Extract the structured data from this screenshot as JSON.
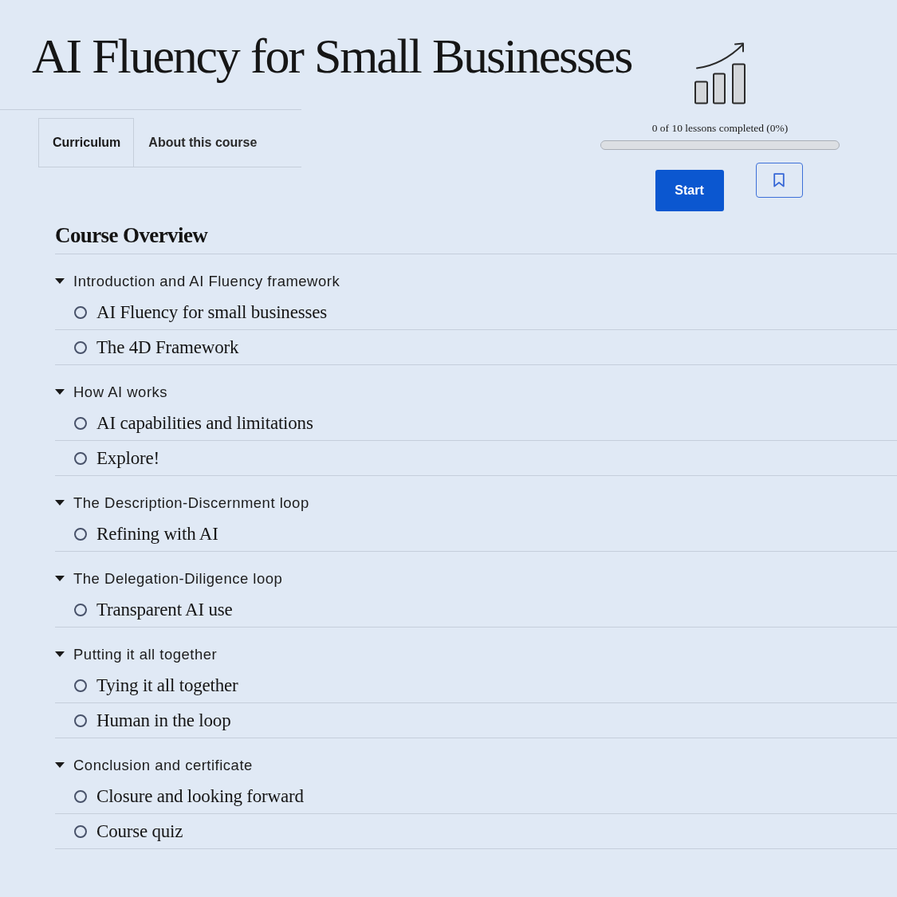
{
  "course": {
    "title": "AI Fluency for Small Businesses"
  },
  "tabs": [
    {
      "label": "Curriculum",
      "selected": true
    },
    {
      "label": "About this course",
      "selected": false
    }
  ],
  "progress": {
    "text": "0 of 10 lessons completed (0%)",
    "level": 0
  },
  "actions": {
    "start_button": "Start"
  },
  "overview": {
    "heading": "Course Overview",
    "sections": [
      {
        "title": "Introduction and AI Fluency framework",
        "expanded": true,
        "lessons": [
          {
            "title": "AI Fluency for small businesses",
            "completed": false
          },
          {
            "title": "The 4D Framework",
            "completed": false
          }
        ]
      },
      {
        "title": "How AI works",
        "expanded": true,
        "lessons": [
          {
            "title": "AI capabilities and limitations",
            "completed": false
          },
          {
            "title": "Explore!",
            "completed": false
          }
        ]
      },
      {
        "title": "The Description-Discernment loop",
        "expanded": true,
        "lessons": [
          {
            "title": "Refining with AI",
            "completed": false
          }
        ]
      },
      {
        "title": "The Delegation-Diligence loop",
        "expanded": true,
        "lessons": [
          {
            "title": "Transparent AI use",
            "completed": false
          }
        ]
      },
      {
        "title": "Putting it all together",
        "expanded": true,
        "lessons": [
          {
            "title": "Tying it all together",
            "completed": false
          },
          {
            "title": "Human in the loop",
            "completed": false
          }
        ]
      },
      {
        "title": "Conclusion and certificate",
        "expanded": true,
        "lessons": [
          {
            "title": "Closure and looking forward",
            "completed": false
          },
          {
            "title": "Course quiz",
            "completed": false
          }
        ]
      }
    ]
  }
}
